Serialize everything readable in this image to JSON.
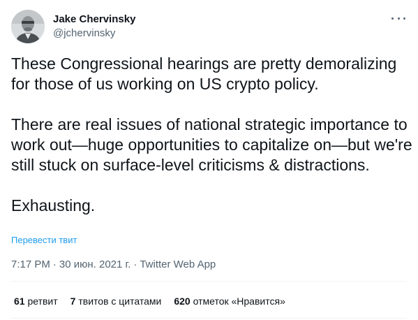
{
  "tweet": {
    "author": {
      "display_name": "Jake Chervinsky",
      "handle": "@jchervinsky"
    },
    "paragraphs": [
      "These Congressional hearings are pretty demoralizing for those of us working on US crypto policy.",
      "There are real issues of national strategic importance to work out—huge opportunities to capitalize on—but we're still stuck on surface-level criticisms & distractions.",
      "Exhausting."
    ],
    "translate_label": "Перевести твит",
    "time": "7:17 PM",
    "separator": "·",
    "date": "30 июн. 2021 г.",
    "source_app": "Twitter Web App",
    "stats": {
      "retweets": {
        "count": "61",
        "label": "ретвит"
      },
      "quotes": {
        "count": "7",
        "label": "твитов с цитатами"
      },
      "likes": {
        "count": "620",
        "label": "отметок «Нравится»"
      }
    }
  },
  "icons": {
    "more": "more-horizontal-icon",
    "avatar": "avatar-photo"
  },
  "colors": {
    "text_primary": "#0f1419",
    "text_secondary": "#536471",
    "link": "#1d9bf0",
    "divider": "#eff3f4"
  }
}
